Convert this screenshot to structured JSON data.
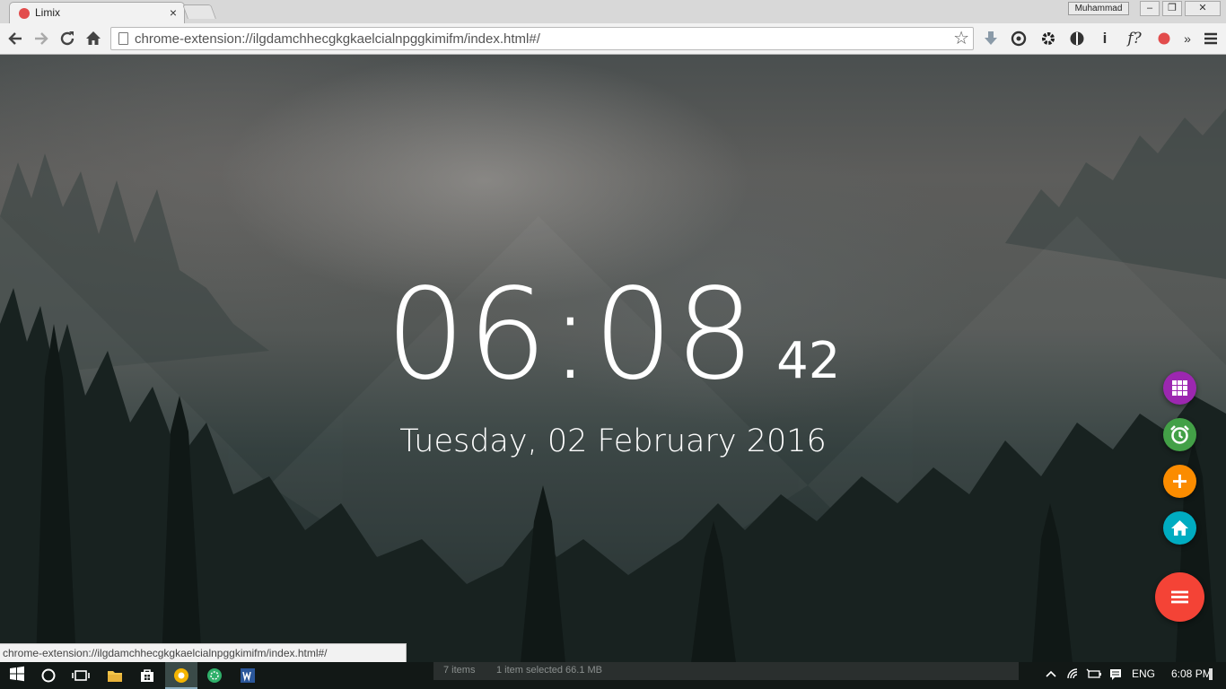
{
  "browser": {
    "tab_title": "Limix",
    "tab_close": "×",
    "profile": "Muhammad",
    "window_minimize": "–",
    "window_restore": "❐",
    "window_close": "✕",
    "address": "chrome-extension://ilgdamchhecgkgkaelcialnpggkimifm/index.html#/",
    "status_url": "chrome-extension://ilgdamchhecgkgkaelcialnpggkimifm/index.html#/",
    "extensions": {
      "info": "i",
      "f_button": "f?",
      "overflow": "»"
    }
  },
  "clock": {
    "hours_minutes": "06:08",
    "seconds": "42",
    "date": "Tuesday, 02 February 2016"
  },
  "fab": {
    "apps_color": "#9c27b0",
    "alarm_color": "#43a047",
    "add_color": "#fb8c00",
    "home_color": "#00acc1",
    "menu_color": "#f44336"
  },
  "taskbar": {
    "explorer_items": "7 items",
    "explorer_selected": "1 item selected  66.1 MB",
    "language": "ENG",
    "time": "6:08 PM"
  }
}
